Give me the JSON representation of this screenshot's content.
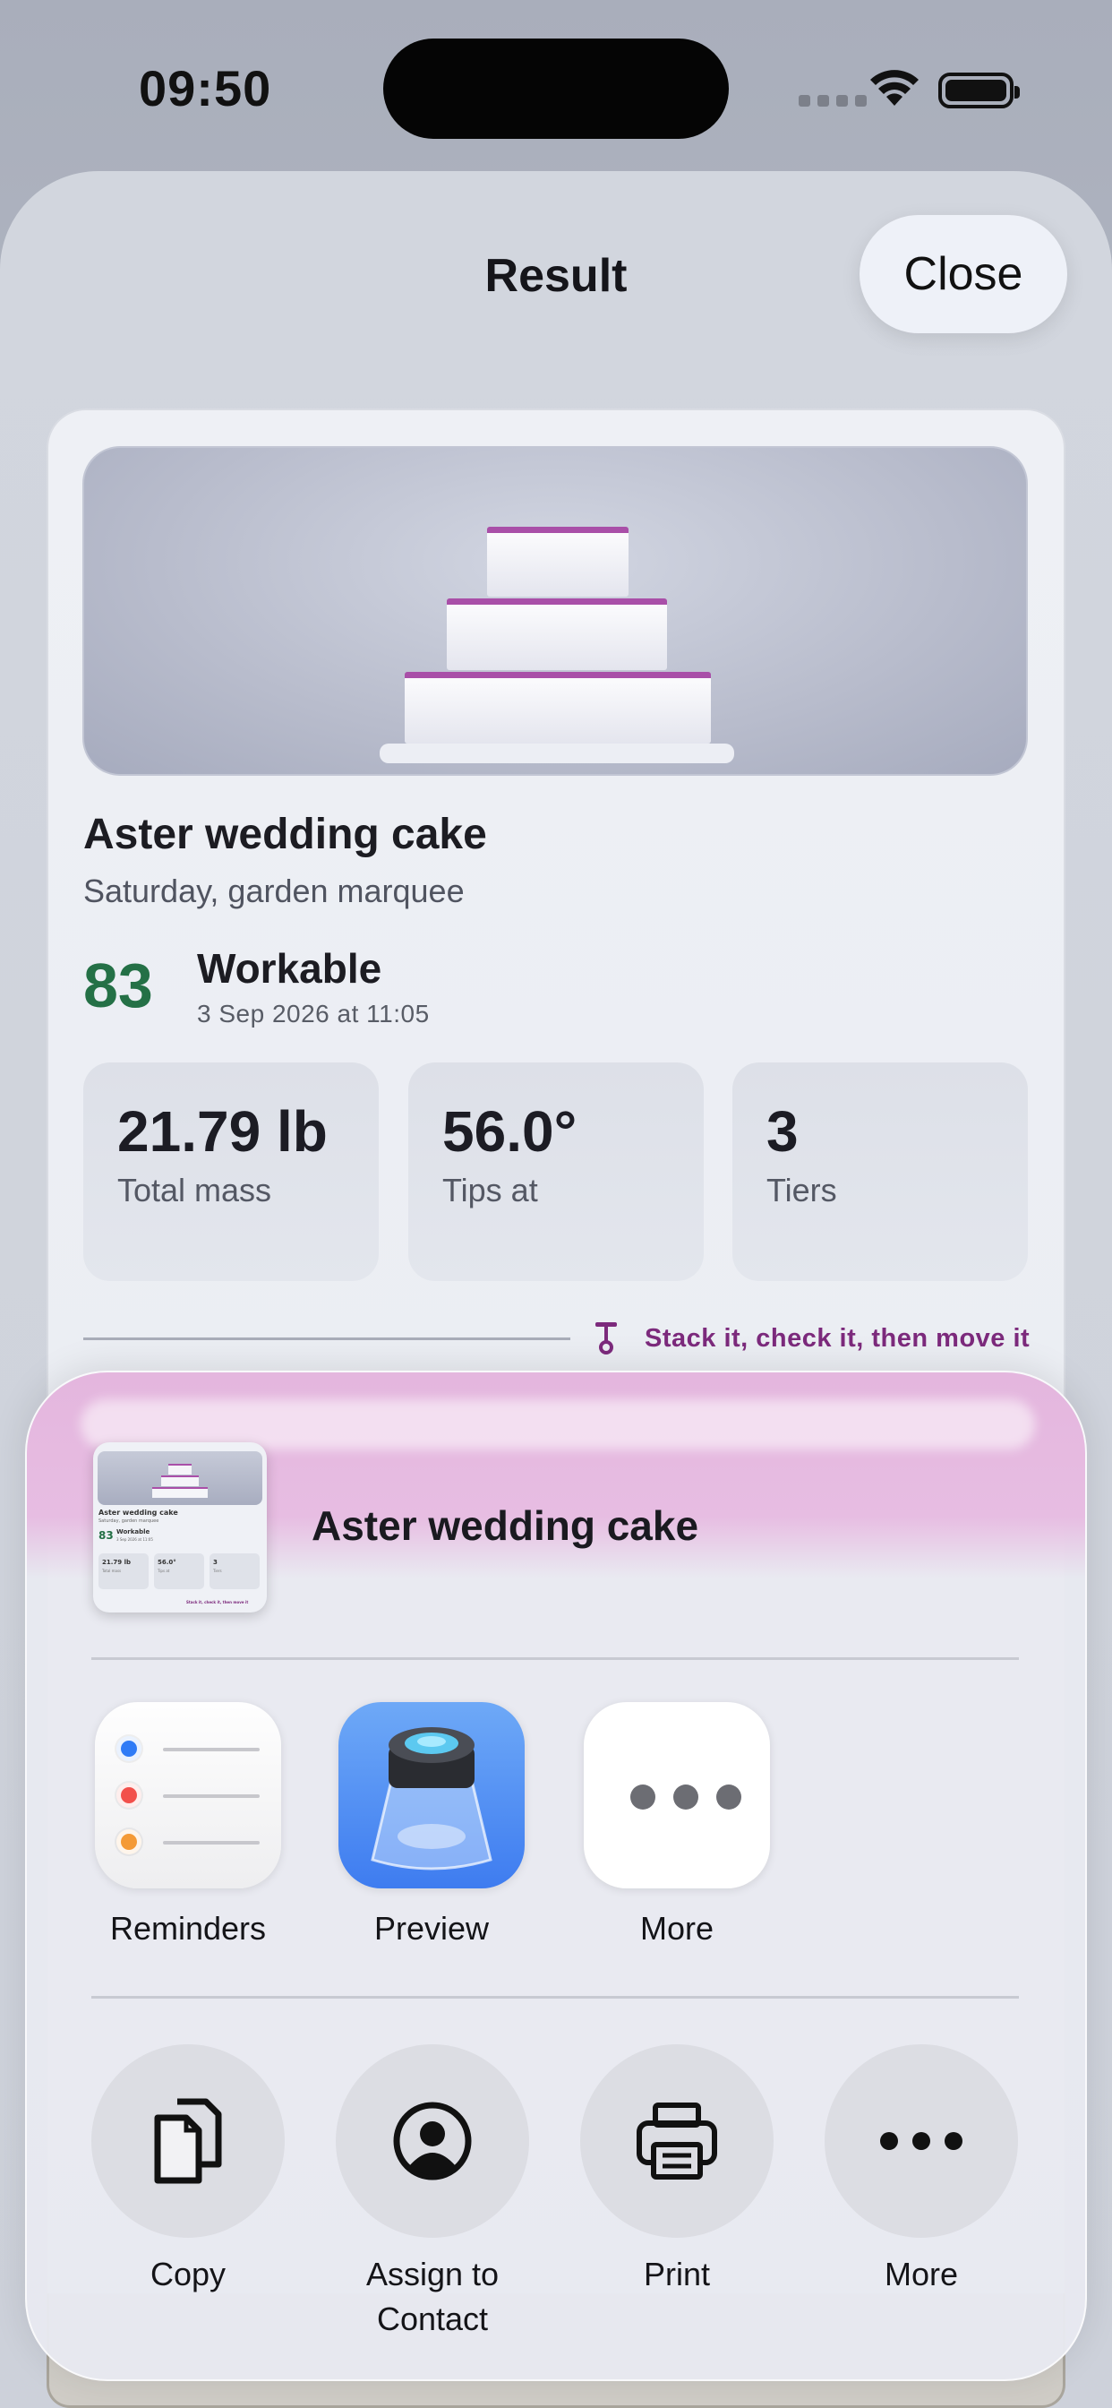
{
  "status_bar": {
    "time": "09:50"
  },
  "sheet": {
    "title": "Result",
    "close_label": "Close"
  },
  "card": {
    "title": "Aster wedding cake",
    "subtitle": "Saturday, garden marquee",
    "score": "83",
    "status": "Workable",
    "date": "3 Sep 2026 at 11:05",
    "stats": [
      {
        "value": "21.79 lb",
        "label": "Total mass"
      },
      {
        "value": "56.0°",
        "label": "Tips at"
      },
      {
        "value": "3",
        "label": "Tiers"
      }
    ],
    "tagline": "Stack it, check it, then move it",
    "colors": {
      "score": "#247046",
      "accent": "#a94fa8",
      "tagline": "#7c2a7c"
    }
  },
  "share_sheet": {
    "title": "Aster wedding cake",
    "thumbnail": {
      "title": "Aster wedding cake",
      "subtitle": "Saturday, garden marquee",
      "score": "83",
      "status": "Workable",
      "date": "3 Sep 2026 at 11:05",
      "stats": [
        {
          "value": "21.79 lb",
          "label": "Total mass"
        },
        {
          "value": "56.0°",
          "label": "Tips at"
        },
        {
          "value": "3",
          "label": "Tiers"
        }
      ],
      "tagline": "Stack it, check it, then move it"
    },
    "apps": [
      {
        "label": "Reminders",
        "icon": "reminders-app-icon"
      },
      {
        "label": "Preview",
        "icon": "preview-app-icon"
      },
      {
        "label": "More",
        "icon": "more-icon"
      }
    ],
    "actions": [
      {
        "label": "Copy",
        "icon": "copy-icon"
      },
      {
        "label": "Assign to Contact",
        "icon": "contact-icon"
      },
      {
        "label": "Print",
        "icon": "print-icon"
      },
      {
        "label": "More",
        "icon": "ellipsis-icon"
      }
    ]
  }
}
